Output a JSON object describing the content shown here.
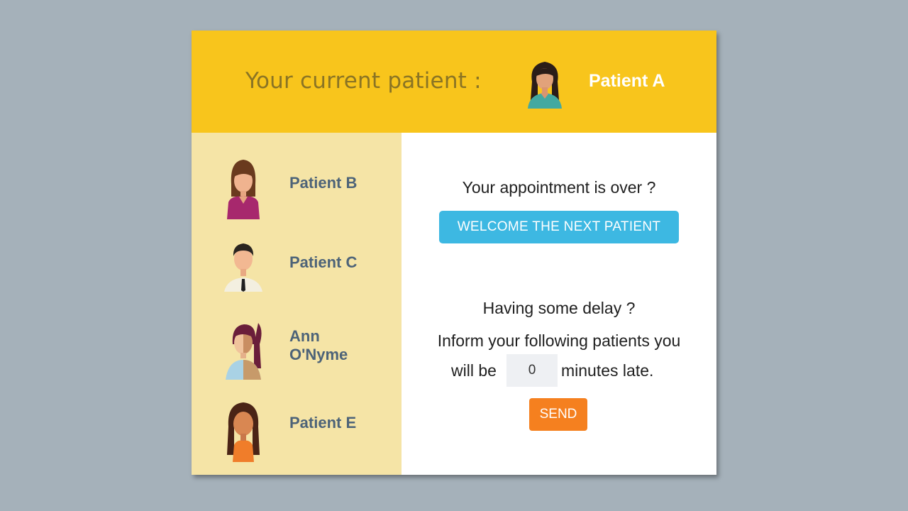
{
  "header": {
    "label": "Your current patient :",
    "current_patient": "Patient A",
    "avatar_icon": "woman-teal-shirt-avatar-icon"
  },
  "sidebar": {
    "patients": [
      {
        "name": "Patient B",
        "avatar_icon": "woman-magenta-avatar-icon"
      },
      {
        "name": "Patient C",
        "avatar_icon": "man-tie-avatar-icon"
      },
      {
        "name": "Ann O'Nyme",
        "avatar_icon": "woman-ponytail-avatar-icon"
      },
      {
        "name": "Patient E",
        "avatar_icon": "girl-braids-avatar-icon"
      }
    ]
  },
  "main": {
    "appointment_question": "Your appointment is over ?",
    "next_button_label": "WELCOME THE NEXT PATIENT",
    "delay_question": "Having some delay ?",
    "inform_text": "Inform your following patients you",
    "will_be": "will be",
    "minutes_value": "0",
    "minutes_late": "minutes late.",
    "send_button_label": "SEND"
  },
  "colors": {
    "background": "#a5b1ba",
    "header": "#f8c51c",
    "sidebar": "#f5e4a6",
    "next_button": "#3db8e2",
    "send_button": "#f5801f",
    "patient_name": "#4d6378"
  }
}
